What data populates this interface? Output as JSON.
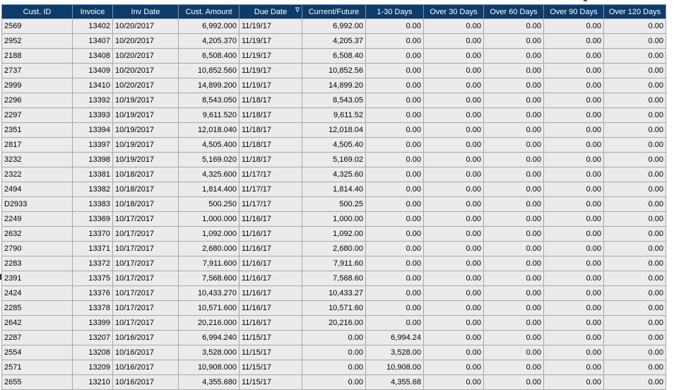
{
  "columns": [
    "Cust. ID",
    "Invoice",
    "Inv Date",
    "Cust. Amount",
    "Due Date",
    "Current/Future",
    "1-30 Days",
    "Over 30 Days",
    "Over 60 Days",
    "Over 90 Days",
    "Over 120 Days"
  ],
  "sort_indicator": "∇",
  "rows": [
    [
      "2569",
      "13402",
      "10/20/2017",
      "6,992.000",
      "11/19/17",
      "6,992.00",
      "0.00",
      "0.00",
      "0.00",
      "0.00",
      "0.00"
    ],
    [
      "2952",
      "13407",
      "10/20/2017",
      "4,205.370",
      "11/19/17",
      "4,205.37",
      "0.00",
      "0.00",
      "0.00",
      "0.00",
      "0.00"
    ],
    [
      "2188",
      "13408",
      "10/20/2017",
      "6,508.400",
      "11/19/17",
      "6,508.40",
      "0.00",
      "0.00",
      "0.00",
      "0.00",
      "0.00"
    ],
    [
      "2737",
      "13409",
      "10/20/2017",
      "10,852.560",
      "11/19/17",
      "10,852.56",
      "0.00",
      "0.00",
      "0.00",
      "0.00",
      "0.00"
    ],
    [
      "2999",
      "13410",
      "10/20/2017",
      "14,899.200",
      "11/19/17",
      "14,899.20",
      "0.00",
      "0.00",
      "0.00",
      "0.00",
      "0.00"
    ],
    [
      "2296",
      "13392",
      "10/19/2017",
      "8,543.050",
      "11/18/17",
      "8,543.05",
      "0.00",
      "0.00",
      "0.00",
      "0.00",
      "0.00"
    ],
    [
      "2297",
      "13393",
      "10/19/2017",
      "9,611.520",
      "11/18/17",
      "9,611.52",
      "0.00",
      "0.00",
      "0.00",
      "0.00",
      "0.00"
    ],
    [
      "2351",
      "13394",
      "10/19/2017",
      "12,018.040",
      "11/18/17",
      "12,018.04",
      "0.00",
      "0.00",
      "0.00",
      "0.00",
      "0.00"
    ],
    [
      "2817",
      "13397",
      "10/19/2017",
      "4,505.400",
      "11/18/17",
      "4,505.40",
      "0.00",
      "0.00",
      "0.00",
      "0.00",
      "0.00"
    ],
    [
      "3232",
      "13398",
      "10/19/2017",
      "5,169.020",
      "11/18/17",
      "5,169.02",
      "0.00",
      "0.00",
      "0.00",
      "0.00",
      "0.00"
    ],
    [
      "2322",
      "13381",
      "10/18/2017",
      "4,325.600",
      "11/17/17",
      "4,325.60",
      "0.00",
      "0.00",
      "0.00",
      "0.00",
      "0.00"
    ],
    [
      "2494",
      "13382",
      "10/18/2017",
      "1,814.400",
      "11/17/17",
      "1,814.40",
      "0.00",
      "0.00",
      "0.00",
      "0.00",
      "0.00"
    ],
    [
      "D2933",
      "13383",
      "10/18/2017",
      "500.250",
      "11/17/17",
      "500.25",
      "0.00",
      "0.00",
      "0.00",
      "0.00",
      "0.00"
    ],
    [
      "2249",
      "13369",
      "10/17/2017",
      "1,000.000",
      "11/16/17",
      "1,000.00",
      "0.00",
      "0.00",
      "0.00",
      "0.00",
      "0.00"
    ],
    [
      "2632",
      "13370",
      "10/17/2017",
      "1,092.000",
      "11/16/17",
      "1,092.00",
      "0.00",
      "0.00",
      "0.00",
      "0.00",
      "0.00"
    ],
    [
      "2790",
      "13371",
      "10/17/2017",
      "2,680.000",
      "11/16/17",
      "2,680.00",
      "0.00",
      "0.00",
      "0.00",
      "0.00",
      "0.00"
    ],
    [
      "2283",
      "13372",
      "10/17/2017",
      "7,911.600",
      "11/16/17",
      "7,911.60",
      "0.00",
      "0.00",
      "0.00",
      "0.00",
      "0.00"
    ],
    [
      "2391",
      "13375",
      "10/17/2017",
      "7,568.600",
      "11/16/17",
      "7,568.60",
      "0.00",
      "0.00",
      "0.00",
      "0.00",
      "0.00"
    ],
    [
      "2424",
      "13376",
      "10/17/2017",
      "10,433.270",
      "11/16/17",
      "10,433.27",
      "0.00",
      "0.00",
      "0.00",
      "0.00",
      "0.00"
    ],
    [
      "2285",
      "13378",
      "10/17/2017",
      "10,571.600",
      "11/16/17",
      "10,571.60",
      "0.00",
      "0.00",
      "0.00",
      "0.00",
      "0.00"
    ],
    [
      "2642",
      "13399",
      "10/17/2017",
      "20,216.000",
      "11/16/17",
      "20,216.00",
      "0.00",
      "0.00",
      "0.00",
      "0.00",
      "0.00"
    ],
    [
      "2287",
      "13207",
      "10/16/2017",
      "6,994.240",
      "11/15/17",
      "0.00",
      "6,994.24",
      "0.00",
      "0.00",
      "0.00",
      "0.00"
    ],
    [
      "2554",
      "13208",
      "10/16/2017",
      "3,528.000",
      "11/15/17",
      "0.00",
      "3,528.00",
      "0.00",
      "0.00",
      "0.00",
      "0.00"
    ],
    [
      "2571",
      "13209",
      "10/16/2017",
      "10,908.000",
      "11/15/17",
      "0.00",
      "10,908.00",
      "0.00",
      "0.00",
      "0.00",
      "0.00"
    ],
    [
      "2655",
      "13210",
      "10/16/2017",
      "4,355.680",
      "11/15/17",
      "0.00",
      "4,355.68",
      "0.00",
      "0.00",
      "0.00",
      "0.00"
    ]
  ],
  "colors": {
    "header_bg": "#0d3b6a",
    "header_text": "#ffffff",
    "cell_bg": "#ebebeb",
    "grid_line": "#a7a7a7"
  }
}
